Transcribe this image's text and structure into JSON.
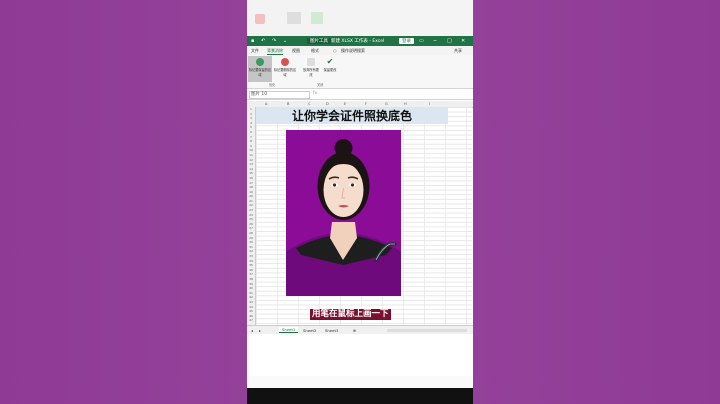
{
  "app": {
    "title_tools": "图片工具",
    "title_file": "新建 XLSX 工作表 - Excel",
    "login": "登录",
    "share": "共享"
  },
  "tabs": [
    "文件",
    "背景消除",
    "视图",
    "格式",
    "操作说明搜索"
  ],
  "ribbon": {
    "btn_keep": "标记要保留的区域",
    "btn_remove": "标记要删除的区域",
    "btn_discard": "放弃所有更改",
    "btn_keep_changes": "保留更改",
    "group_refine": "优化",
    "group_close": "关闭"
  },
  "namebox": "图片 10",
  "fx": "fx",
  "columns": [
    "A",
    "B",
    "C",
    "D",
    "E",
    "F",
    "G",
    "H",
    "I"
  ],
  "rows": [
    "1",
    "2",
    "3",
    "4",
    "5",
    "6",
    "7",
    "8",
    "9",
    "10",
    "11",
    "12",
    "13",
    "14",
    "15",
    "16",
    "17",
    "18",
    "19",
    "20",
    "21",
    "22",
    "23",
    "24",
    "25",
    "26",
    "27",
    "28",
    "29",
    "30",
    "31",
    "32",
    "33",
    "34",
    "35",
    "36",
    "37",
    "38",
    "39",
    "40",
    "41",
    "42",
    "43",
    "44",
    "45",
    "46",
    "47"
  ],
  "sheet_title": "让你学会证件照换底色",
  "subtitle": "用笔在鼠标上画一下",
  "sheets": [
    "Sheet1",
    "Sheet2",
    "Sheet3"
  ],
  "colors": {
    "photo_bg": "#8a0c97",
    "excel_green": "#217346",
    "side_bg": "#8e3a95"
  }
}
